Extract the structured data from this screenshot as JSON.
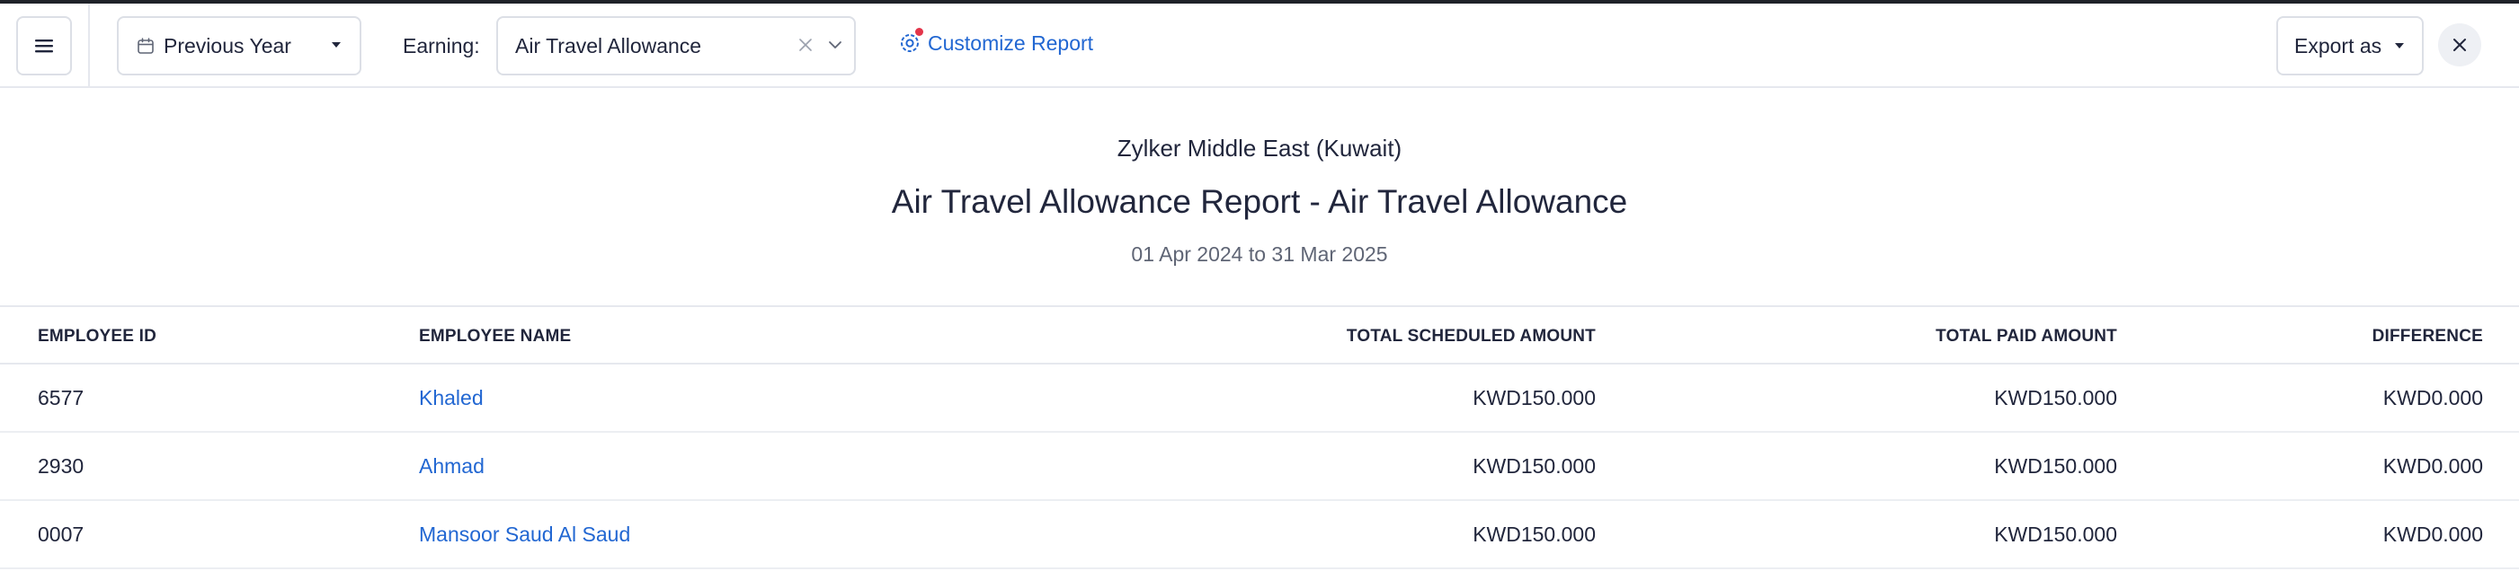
{
  "toolbar": {
    "period_label": "Previous Year",
    "earning_label": "Earning:",
    "earning_value": "Air Travel Allowance",
    "customize_label": "Customize Report",
    "export_label": "Export as"
  },
  "report": {
    "organization": "Zylker Middle East (Kuwait)",
    "title": "Air Travel Allowance Report - Air Travel Allowance",
    "period": "01 Apr 2024 to 31 Mar 2025"
  },
  "table": {
    "columns": [
      "EMPLOYEE ID",
      "EMPLOYEE NAME",
      "TOTAL SCHEDULED AMOUNT",
      "TOTAL PAID AMOUNT",
      "DIFFERENCE"
    ],
    "rows": [
      {
        "id": "6577",
        "name": "Khaled",
        "scheduled": "KWD150.000",
        "paid": "KWD150.000",
        "difference": "KWD0.000"
      },
      {
        "id": "2930",
        "name": "Ahmad",
        "scheduled": "KWD150.000",
        "paid": "KWD150.000",
        "difference": "KWD0.000"
      },
      {
        "id": "0007",
        "name": "Mansoor Saud Al Saud",
        "scheduled": "KWD150.000",
        "paid": "KWD150.000",
        "difference": "KWD0.000"
      }
    ]
  },
  "icons": {
    "menu": "hamburger-menu-icon",
    "calendar": "calendar-icon",
    "caret": "caret-down-icon",
    "clear": "clear-x-icon",
    "chevron": "chevron-down-icon",
    "settings": "gear-icon",
    "close": "close-icon"
  },
  "colors": {
    "accent": "#2267d2",
    "notification_dot": "#e3354a",
    "border": "#dcdfe6"
  }
}
